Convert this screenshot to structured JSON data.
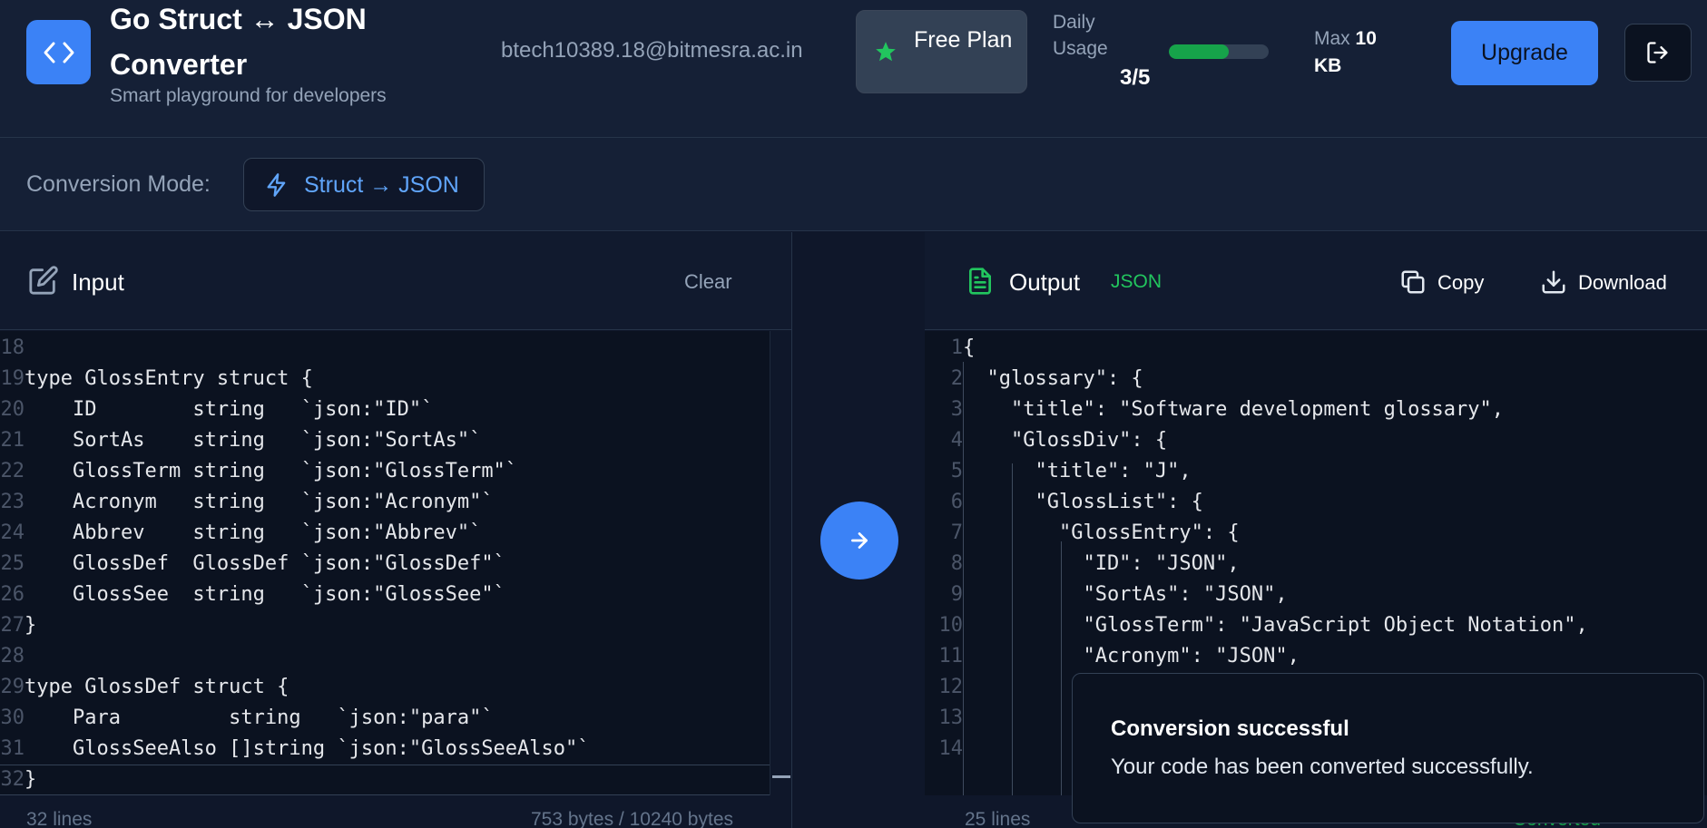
{
  "header": {
    "title": "Go Struct ↔ JSON Converter",
    "subtitle": "Smart playground for developers",
    "email": "btech10389.18@bitmesra.ac.in",
    "plan_label": "Free Plan",
    "daily_label": "Daily Usage",
    "usage_value": "3/5",
    "usage_fraction": 0.6,
    "max_prefix": "Max",
    "max_value": "10",
    "max_unit": "KB",
    "upgrade_label": "Upgrade"
  },
  "mode": {
    "label": "Conversion Mode:",
    "value": "Struct → JSON"
  },
  "input": {
    "title": "Input",
    "clear_label": "Clear",
    "lines": [
      {
        "n": "18",
        "t": ""
      },
      {
        "n": "19",
        "t": "type GlossEntry struct {"
      },
      {
        "n": "20",
        "t": "    ID        string   `json:\"ID\"`"
      },
      {
        "n": "21",
        "t": "    SortAs    string   `json:\"SortAs\"`"
      },
      {
        "n": "22",
        "t": "    GlossTerm string   `json:\"GlossTerm\"`"
      },
      {
        "n": "23",
        "t": "    Acronym   string   `json:\"Acronym\"`"
      },
      {
        "n": "24",
        "t": "    Abbrev    string   `json:\"Abbrev\"`"
      },
      {
        "n": "25",
        "t": "    GlossDef  GlossDef `json:\"GlossDef\"`"
      },
      {
        "n": "26",
        "t": "    GlossSee  string   `json:\"GlossSee\"`"
      },
      {
        "n": "27",
        "t": "}"
      },
      {
        "n": "28",
        "t": ""
      },
      {
        "n": "29",
        "t": "type GlossDef struct {"
      },
      {
        "n": "30",
        "t": "    Para         string   `json:\"para\"`"
      },
      {
        "n": "31",
        "t": "    GlossSeeAlso []string `json:\"GlossSeeAlso\"`"
      },
      {
        "n": "32",
        "t": "}"
      }
    ],
    "line_count": "32 lines",
    "byte_count": "753 bytes / 10240 bytes"
  },
  "output": {
    "title": "Output",
    "format": "JSON",
    "copy_label": "Copy",
    "download_label": "Download",
    "lines": [
      {
        "n": "1",
        "t": "{"
      },
      {
        "n": "2",
        "t": "  \"glossary\": {"
      },
      {
        "n": "3",
        "t": "    \"title\": \"Software development glossary\","
      },
      {
        "n": "4",
        "t": "    \"GlossDiv\": {"
      },
      {
        "n": "5",
        "t": "      \"title\": \"J\","
      },
      {
        "n": "6",
        "t": "      \"GlossList\": {"
      },
      {
        "n": "7",
        "t": "        \"GlossEntry\": {"
      },
      {
        "n": "8",
        "t": "          \"ID\": \"JSON\","
      },
      {
        "n": "9",
        "t": "          \"SortAs\": \"JSON\","
      },
      {
        "n": "10",
        "t": "          \"GlossTerm\": \"JavaScript Object Notation\","
      },
      {
        "n": "11",
        "t": "          \"Acronym\": \"JSON\","
      },
      {
        "n": "12",
        "t": ""
      },
      {
        "n": "13",
        "t": ""
      },
      {
        "n": "14",
        "t": ""
      }
    ],
    "line_count": "25 lines",
    "status": "Converted successfully"
  },
  "toast": {
    "title": "Conversion successful",
    "message": "Your code has been converted successfully."
  },
  "colors": {
    "accent": "#3b82f6",
    "success": "#22c55e",
    "background": "#0f172a",
    "header": "#152036"
  }
}
